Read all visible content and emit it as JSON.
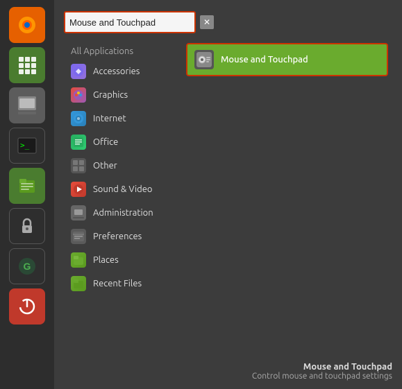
{
  "sidebar": {
    "icons": [
      {
        "name": "firefox",
        "label": "Firefox",
        "class": "firefox",
        "symbol": "🦊"
      },
      {
        "name": "apps",
        "label": "App Grid",
        "class": "apps",
        "symbol": "⊞"
      },
      {
        "name": "settings",
        "label": "Settings",
        "class": "settings",
        "symbol": "🖥"
      },
      {
        "name": "terminal",
        "label": "Terminal",
        "class": "terminal",
        "symbol": ">_"
      },
      {
        "name": "files",
        "label": "Files",
        "class": "files",
        "symbol": "📁"
      },
      {
        "name": "lock",
        "label": "Lock",
        "class": "lock",
        "symbol": "🔒"
      },
      {
        "name": "grammarly",
        "label": "Grammarly",
        "class": "grammarly",
        "symbol": "G"
      },
      {
        "name": "power",
        "label": "Power",
        "class": "power",
        "symbol": "⏻"
      }
    ]
  },
  "search": {
    "value": "Mouse and Touchpad",
    "clear_label": "✕"
  },
  "categories": {
    "all_label": "All Applications",
    "items": [
      {
        "name": "accessories",
        "label": "Accessories",
        "icon_class": "icon-accessories",
        "symbol": "✦"
      },
      {
        "name": "graphics",
        "label": "Graphics",
        "icon_class": "icon-graphics",
        "symbol": "🎨"
      },
      {
        "name": "internet",
        "label": "Internet",
        "icon_class": "icon-internet",
        "symbol": "🌐"
      },
      {
        "name": "office",
        "label": "Office",
        "icon_class": "icon-office",
        "symbol": "📊"
      },
      {
        "name": "other",
        "label": "Other",
        "icon_class": "icon-other",
        "symbol": "⊞"
      },
      {
        "name": "sound-video",
        "label": "Sound & Video",
        "icon_class": "icon-sound",
        "symbol": "▶"
      },
      {
        "name": "administration",
        "label": "Administration",
        "icon_class": "icon-admin",
        "symbol": "🖥"
      },
      {
        "name": "preferences",
        "label": "Preferences",
        "icon_class": "icon-prefs",
        "symbol": "🗃"
      },
      {
        "name": "places",
        "label": "Places",
        "icon_class": "icon-places",
        "symbol": "📁"
      },
      {
        "name": "recent-files",
        "label": "Recent Files",
        "icon_class": "icon-recent",
        "symbol": "📁"
      }
    ]
  },
  "results": [
    {
      "name": "mouse-and-touchpad",
      "label": "Mouse and Touchpad",
      "symbol": "🖱"
    }
  ],
  "status": {
    "app_name": "Mouse and Touchpad",
    "app_desc": "Control mouse and touchpad settings"
  }
}
